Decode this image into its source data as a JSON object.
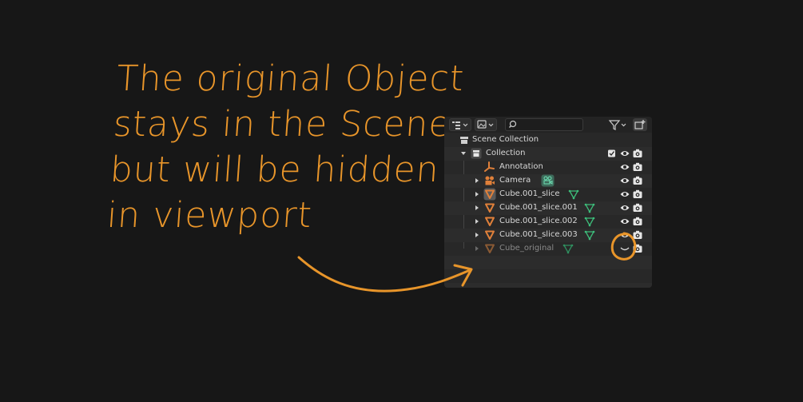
{
  "annotation": {
    "lines": [
      "The original Object",
      "stays in the Scene",
      "but will be hidden",
      "in viewport"
    ],
    "color": "#e8952a"
  },
  "outliner": {
    "toolbar": {
      "display_mode_icon": "outliner-display-icon",
      "view_layer_icon": "view-layer-icon",
      "search_icon": "search-icon",
      "search_value": "",
      "filter_icon": "filter-icon",
      "new_collection_icon": "new-collection-icon"
    },
    "scene_collection": "Scene Collection",
    "collection": "Collection",
    "items": [
      {
        "label": "Annotation"
      },
      {
        "label": "Camera"
      },
      {
        "label": "Cube.001_slice"
      },
      {
        "label": "Cube.001_slice.001"
      },
      {
        "label": "Cube.001_slice.002"
      },
      {
        "label": "Cube.001_slice.003"
      },
      {
        "label": "Cube_original"
      }
    ],
    "colors": {
      "object_orange": "#e0803a",
      "mesh_green": "#3dbd7a",
      "hidden_text": "#8a8a8a"
    }
  }
}
